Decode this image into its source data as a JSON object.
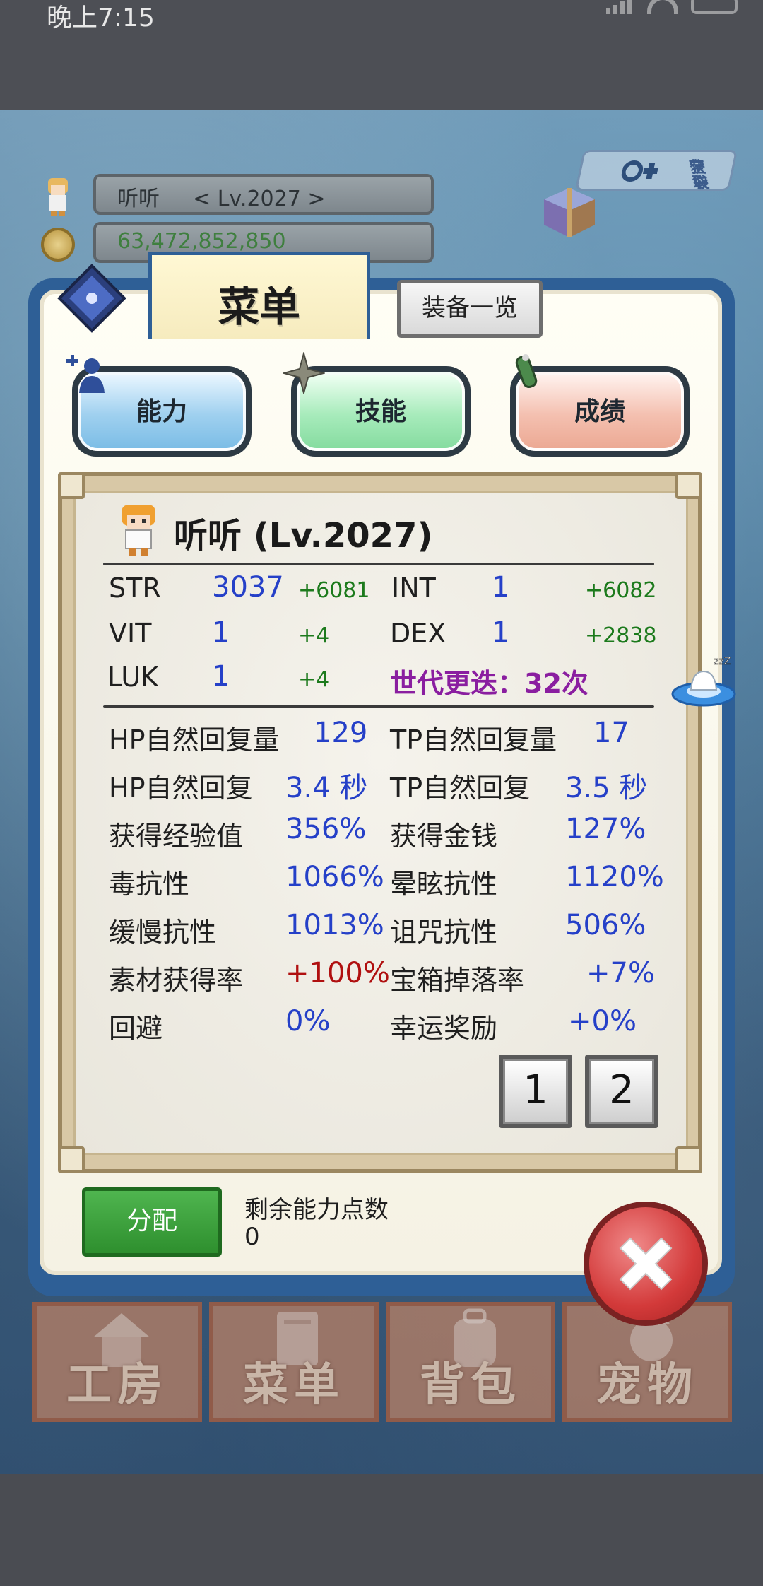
{
  "status_bar": {
    "time": "晚上7:15"
  },
  "hud": {
    "player_name": "听听",
    "player_level": "< Lv.2027 >",
    "gold": "63,472,852,850",
    "bonus_badge_line1": "获取",
    "bonus_badge_line2": "宝袋"
  },
  "menu": {
    "title": "菜单",
    "equip_list_label": "装备一览",
    "categories": [
      {
        "label": "能力",
        "color": "#9fd0ef"
      },
      {
        "label": "技能",
        "color": "#a7ebbb"
      },
      {
        "label": "成绩",
        "color": "#f4c0b0"
      }
    ]
  },
  "character": {
    "title": "听听 (Lv.2027)",
    "base_stats": [
      {
        "name": "STR",
        "value": "3037",
        "bonus": "+6081"
      },
      {
        "name": "INT",
        "value": "1",
        "bonus": "+6082"
      },
      {
        "name": "VIT",
        "value": "1",
        "bonus": "+4"
      },
      {
        "name": "DEX",
        "value": "1",
        "bonus": "+2838"
      },
      {
        "name": "LUK",
        "value": "1",
        "bonus": "+4"
      }
    ],
    "generation": "世代更迭：32次",
    "attributes": [
      {
        "label": "HP自然回复量",
        "value": "129"
      },
      {
        "label": "TP自然回复量",
        "value": "17"
      },
      {
        "label": "HP自然回复",
        "value": "3.4 秒"
      },
      {
        "label": "TP自然回复",
        "value": "3.5 秒"
      },
      {
        "label": "获得经验值",
        "value": "356%"
      },
      {
        "label": "获得金钱",
        "value": "127%"
      },
      {
        "label": "毒抗性",
        "value": "1066%"
      },
      {
        "label": "晕眩抗性",
        "value": "1120%"
      },
      {
        "label": "缓慢抗性",
        "value": "1013%"
      },
      {
        "label": "诅咒抗性",
        "value": "506%"
      },
      {
        "label": "素材获得率",
        "value": "+100%"
      },
      {
        "label": "宝箱掉落率",
        "value": "+7%"
      },
      {
        "label": "回避",
        "value": "0%"
      },
      {
        "label": "幸运奖励",
        "value": "+0%"
      }
    ],
    "pages": [
      "1",
      "2"
    ]
  },
  "footer": {
    "assign_label": "分配",
    "remaining_points_label": "剩余能力点数",
    "remaining_points": "0"
  },
  "bottom_nav": [
    {
      "label": "工房"
    },
    {
      "label": "菜单"
    },
    {
      "label": "背包"
    },
    {
      "label": "宠物"
    }
  ],
  "colors": {
    "panel_frame": "#2e5f96",
    "stat_value_blue": "#2540c8",
    "bonus_green": "#1c7a1c",
    "highlight_red": "#b01010",
    "generation_purple": "#8a1ea0"
  }
}
